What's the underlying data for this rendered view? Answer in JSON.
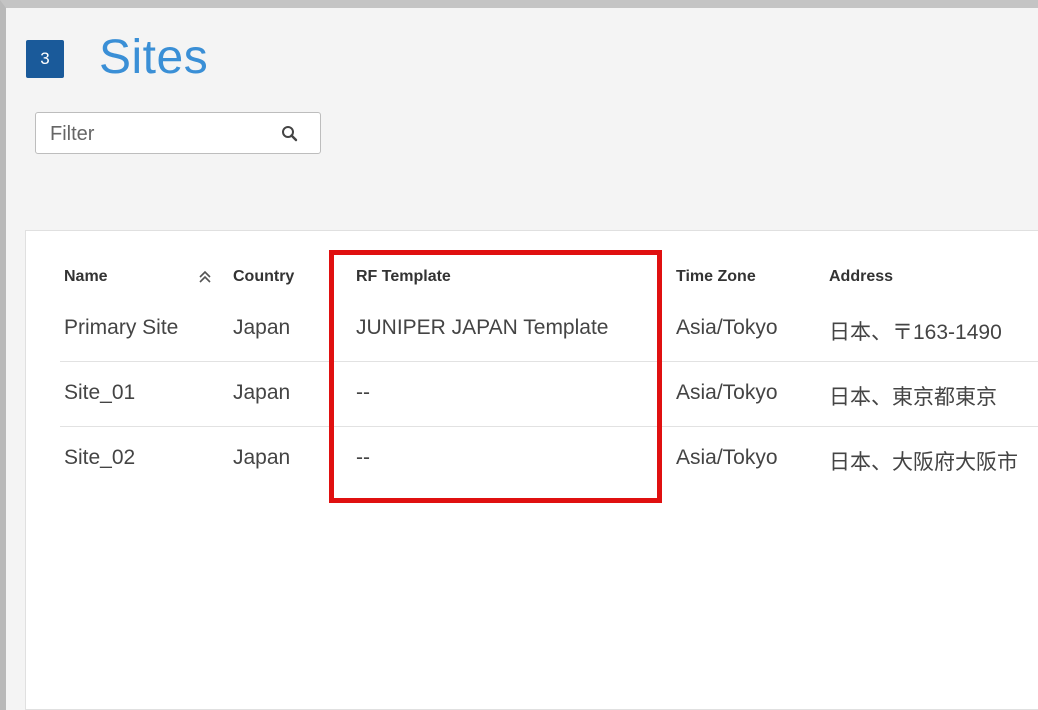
{
  "page": {
    "badge_count": "3",
    "title": "Sites"
  },
  "filter": {
    "placeholder": "Filter"
  },
  "table": {
    "columns": [
      "Name",
      "Country",
      "RF Template",
      "Time Zone",
      "Address"
    ],
    "sorted_column": "Name",
    "sort_direction": "ascending",
    "rows": [
      {
        "name": "Primary Site",
        "country": "Japan",
        "rf_template": "JUNIPER JAPAN Template",
        "time_zone": "Asia/Tokyo",
        "address": "日本、〒163-1490"
      },
      {
        "name": "Site_01",
        "country": "Japan",
        "rf_template": "--",
        "time_zone": "Asia/Tokyo",
        "address": "日本、東京都東京"
      },
      {
        "name": "Site_02",
        "country": "Japan",
        "rf_template": "--",
        "time_zone": "Asia/Tokyo",
        "address": "日本、大阪府大阪市"
      }
    ]
  },
  "colors": {
    "badge": "#1a5a9a",
    "title": "#3a8fd6",
    "highlight": "#e01010"
  },
  "icons": {
    "search": "search-icon",
    "sort": "sort-ascending-icon"
  }
}
